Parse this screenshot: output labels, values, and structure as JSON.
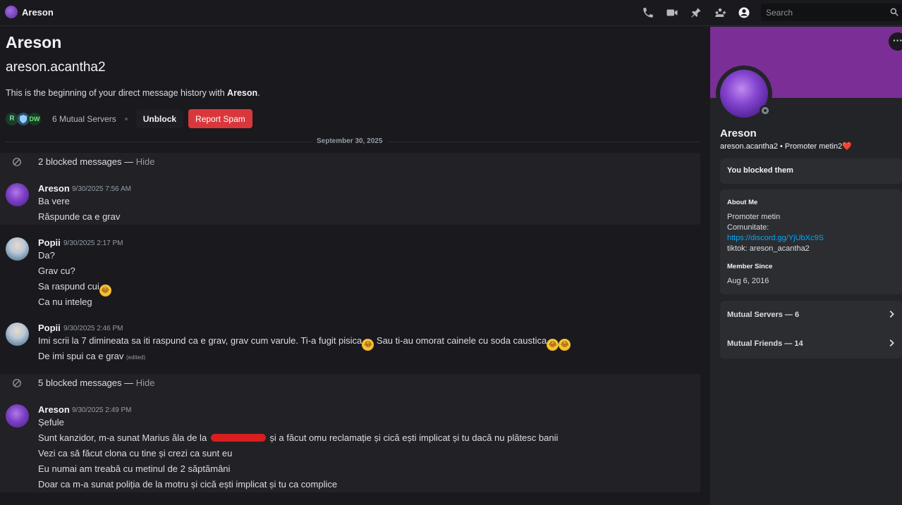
{
  "topbar": {
    "title": "Areson",
    "icons": [
      "phone-call-icon",
      "video-camera-icon",
      "pin-icon",
      "add-friend-icon",
      "user-profile-icon"
    ],
    "search_placeholder": "Search"
  },
  "header": {
    "display_name": "Areson",
    "username": "areson.acantha2",
    "intro_prefix": "This is the beginning of your direct message history with ",
    "intro_name": "Areson",
    "intro_suffix": ".",
    "mutual_servers_label": "6 Mutual Servers",
    "unblock_label": "Unblock",
    "report_spam_label": "Report Spam",
    "server_icons": [
      "R",
      "",
      "DW"
    ]
  },
  "date_divider": "September 30, 2025",
  "blocked": [
    {
      "text": "2 blocked messages — ",
      "hide": "Hide"
    },
    {
      "text": "5 blocked messages — ",
      "hide": "Hide"
    }
  ],
  "messages": [
    {
      "author": "Areson",
      "time": "9/30/2025 7:56 AM",
      "lines": [
        "Ba vere",
        "Răspunde ca e grav"
      ]
    },
    {
      "author": "Popii",
      "time": "9/30/2025 2:17 PM",
      "lines": [
        "Da?",
        "Grav cu?",
        "Sa raspund cui",
        "Ca nu inteleg"
      ]
    },
    {
      "author": "Popii",
      "time": "9/30/2025 2:46 PM",
      "lines": [
        "Imi scrii la 7 dimineata sa iti raspund ca e grav, grav cum varule. Ti-a fugit pisica",
        " Sau ti-au omorat cainele cu soda caustica",
        "De imi spui ca e grav"
      ],
      "edited": "(edited)"
    },
    {
      "author": "Areson",
      "time": "9/30/2025 2:49 PM",
      "lines": [
        "Șefule",
        "Sunt kanzidor, m-a sunat Marius ăla de la ",
        " și a făcut omu reclamație și cică ești implicat și tu dacă nu plătesc banii",
        "Vezi ca să făcut clona cu tine și crezi ca sunt eu",
        "Eu numai am treabă cu metinul de 2 săptămâni",
        "Doar ca m-a sunat poliția de la motru și cică ești implicat și tu ca complice"
      ]
    }
  ],
  "profile": {
    "display_name": "Areson",
    "username": "areson.acantha2",
    "pronoun_sep": " • ",
    "status": "Promoter metin2",
    "heart": "❤️",
    "blocked_notice": "You blocked them",
    "about_heading": "About Me",
    "about_line1": "Promoter metin",
    "about_line2": "Comunitate:",
    "about_link": "https://discord.gg/YjUbXc9S",
    "about_line4": "tiktok: areson_acantha2",
    "member_since_heading": "Member Since",
    "member_since": "Aug 6, 2016",
    "mutual_servers": "Mutual Servers — 6",
    "mutual_friends": "Mutual Friends — 14",
    "banner_color": "#7a2e96"
  }
}
